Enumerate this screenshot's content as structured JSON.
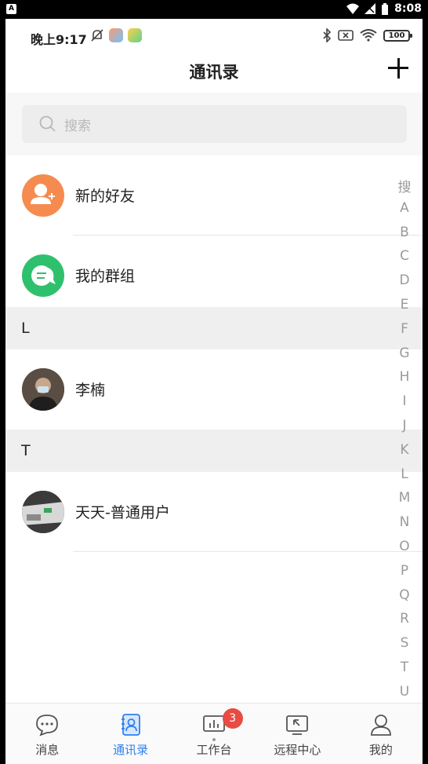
{
  "system_bar": {
    "time": "8:08"
  },
  "status_bar": {
    "time": "晚上9:17",
    "battery": "100"
  },
  "header": {
    "title": "通讯录"
  },
  "search": {
    "placeholder": "搜索"
  },
  "shortcuts": [
    {
      "label": "新的好友",
      "icon": "add-friend-icon",
      "color": "#f58b4f"
    },
    {
      "label": "我的群组",
      "icon": "group-chat-icon",
      "color": "#2fc06e"
    }
  ],
  "sections": [
    {
      "letter": "L",
      "contacts": [
        {
          "name": "李楠"
        }
      ]
    },
    {
      "letter": "T",
      "contacts": [
        {
          "name": "天天-普通用户"
        }
      ]
    }
  ],
  "index_letters": [
    "搜",
    "A",
    "B",
    "C",
    "D",
    "E",
    "F",
    "G",
    "H",
    "I",
    "J",
    "K",
    "L",
    "M",
    "N",
    "O",
    "P",
    "Q",
    "R",
    "S",
    "T",
    "U"
  ],
  "tabs": [
    {
      "label": "消息",
      "icon": "message-icon"
    },
    {
      "label": "通讯录",
      "icon": "contacts-icon",
      "active": true
    },
    {
      "label": "工作台",
      "icon": "workbench-icon",
      "badge": "3"
    },
    {
      "label": "远程中心",
      "icon": "remote-icon"
    },
    {
      "label": "我的",
      "icon": "profile-icon"
    }
  ],
  "colors": {
    "accent": "#2f7ff1",
    "badge": "#e84b43"
  }
}
